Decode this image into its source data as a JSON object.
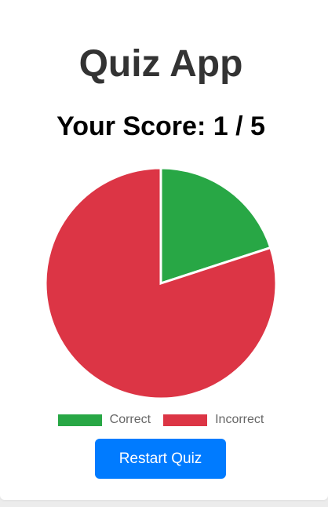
{
  "app": {
    "title": "Quiz App"
  },
  "score": {
    "prefix": "Your Score:",
    "correct": "1",
    "separator": "/",
    "total": "5"
  },
  "colors": {
    "correct": "#28a745",
    "incorrect": "#dc3545",
    "button": "#007bff"
  },
  "chart_data": {
    "type": "pie",
    "title": "",
    "categories": [
      "Correct",
      "Incorrect"
    ],
    "values": [
      1,
      4
    ],
    "colors": [
      "#28a745",
      "#dc3545"
    ],
    "legend": "bottom"
  },
  "legend": {
    "items": [
      {
        "label": "Correct"
      },
      {
        "label": "Incorrect"
      }
    ]
  },
  "actions": {
    "restart_label": "Restart Quiz"
  }
}
